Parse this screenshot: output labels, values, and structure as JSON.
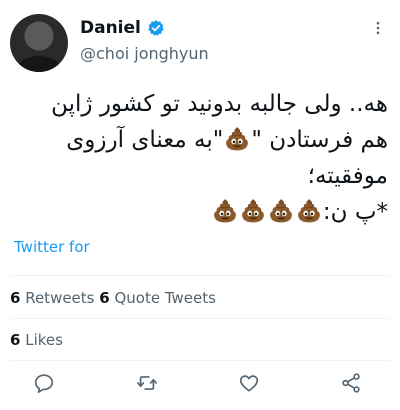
{
  "header": {
    "name": "Daniel",
    "handle": "@choi jonghyun",
    "verified_color": "#1d9bf0",
    "more_icon": "vertical-ellipsis-icon"
  },
  "tweet": {
    "line1": "هه.. ولی جالبه بدونید تو کشور ژاپن",
    "line2_before": "هم فرستادن \"",
    "line2_after": "\"به معنای آرزوی",
    "line3": "موفقیته؛",
    "line4_prefix": "*پ ن:",
    "emoji_name": "pile-of-poo-emoji"
  },
  "source": "Twitter for",
  "stats": {
    "retweets_count": "6",
    "retweets_label": " Retweets ",
    "quote_count": "6",
    "quote_label": " Quote Tweets",
    "likes_count": "6",
    "likes_label": " Likes"
  },
  "actions": {
    "reply_icon": "reply-icon",
    "retweet_icon": "retweet-icon",
    "like_icon": "heart-icon",
    "share_icon": "share-icon",
    "icon_color": "#536471"
  }
}
